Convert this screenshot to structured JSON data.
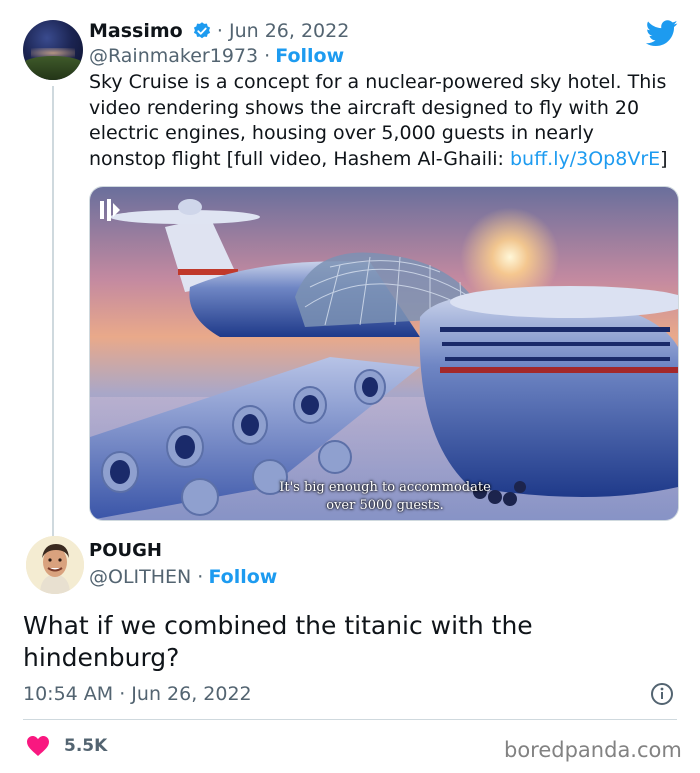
{
  "quoted_tweet": {
    "name": "Massimo",
    "date": "· Jun 26, 2022",
    "handle": "@Rainmaker1973 ·",
    "follow_label": "Follow",
    "text_lines": [
      "Sky Cruise is a concept for a nuclear-powered sky hotel. This",
      "video rendering shows the aircraft designed to fly with 20",
      "electric engines, housing over 5,000 guests in nearly",
      "nonstop flight [full video, Hashem Al-Ghaili: "
    ],
    "link_text": "buff.ly/3Op8VrE",
    "text_tail": "]",
    "media_caption_line1": "It's big enough to accommodate",
    "media_caption_line2": "over 5000 guests."
  },
  "reply": {
    "name": "POUGH",
    "handle": "@OLITHEN ·",
    "follow_label": "Follow",
    "text_line1": "What if we combined the titanic with the",
    "text_line2": "hindenburg?",
    "timestamp": "10:54 AM · Jun 26, 2022",
    "like_count": "5.5K"
  },
  "watermark": "boredpanda.com",
  "colors": {
    "link": "#1d9bf0",
    "twitter_blue": "#1d9bf0",
    "heart": "#f91880",
    "muted": "#536471"
  },
  "icons": [
    "verified-badge-icon",
    "twitter-bird-icon",
    "video-brand-icon",
    "info-icon",
    "heart-icon"
  ]
}
